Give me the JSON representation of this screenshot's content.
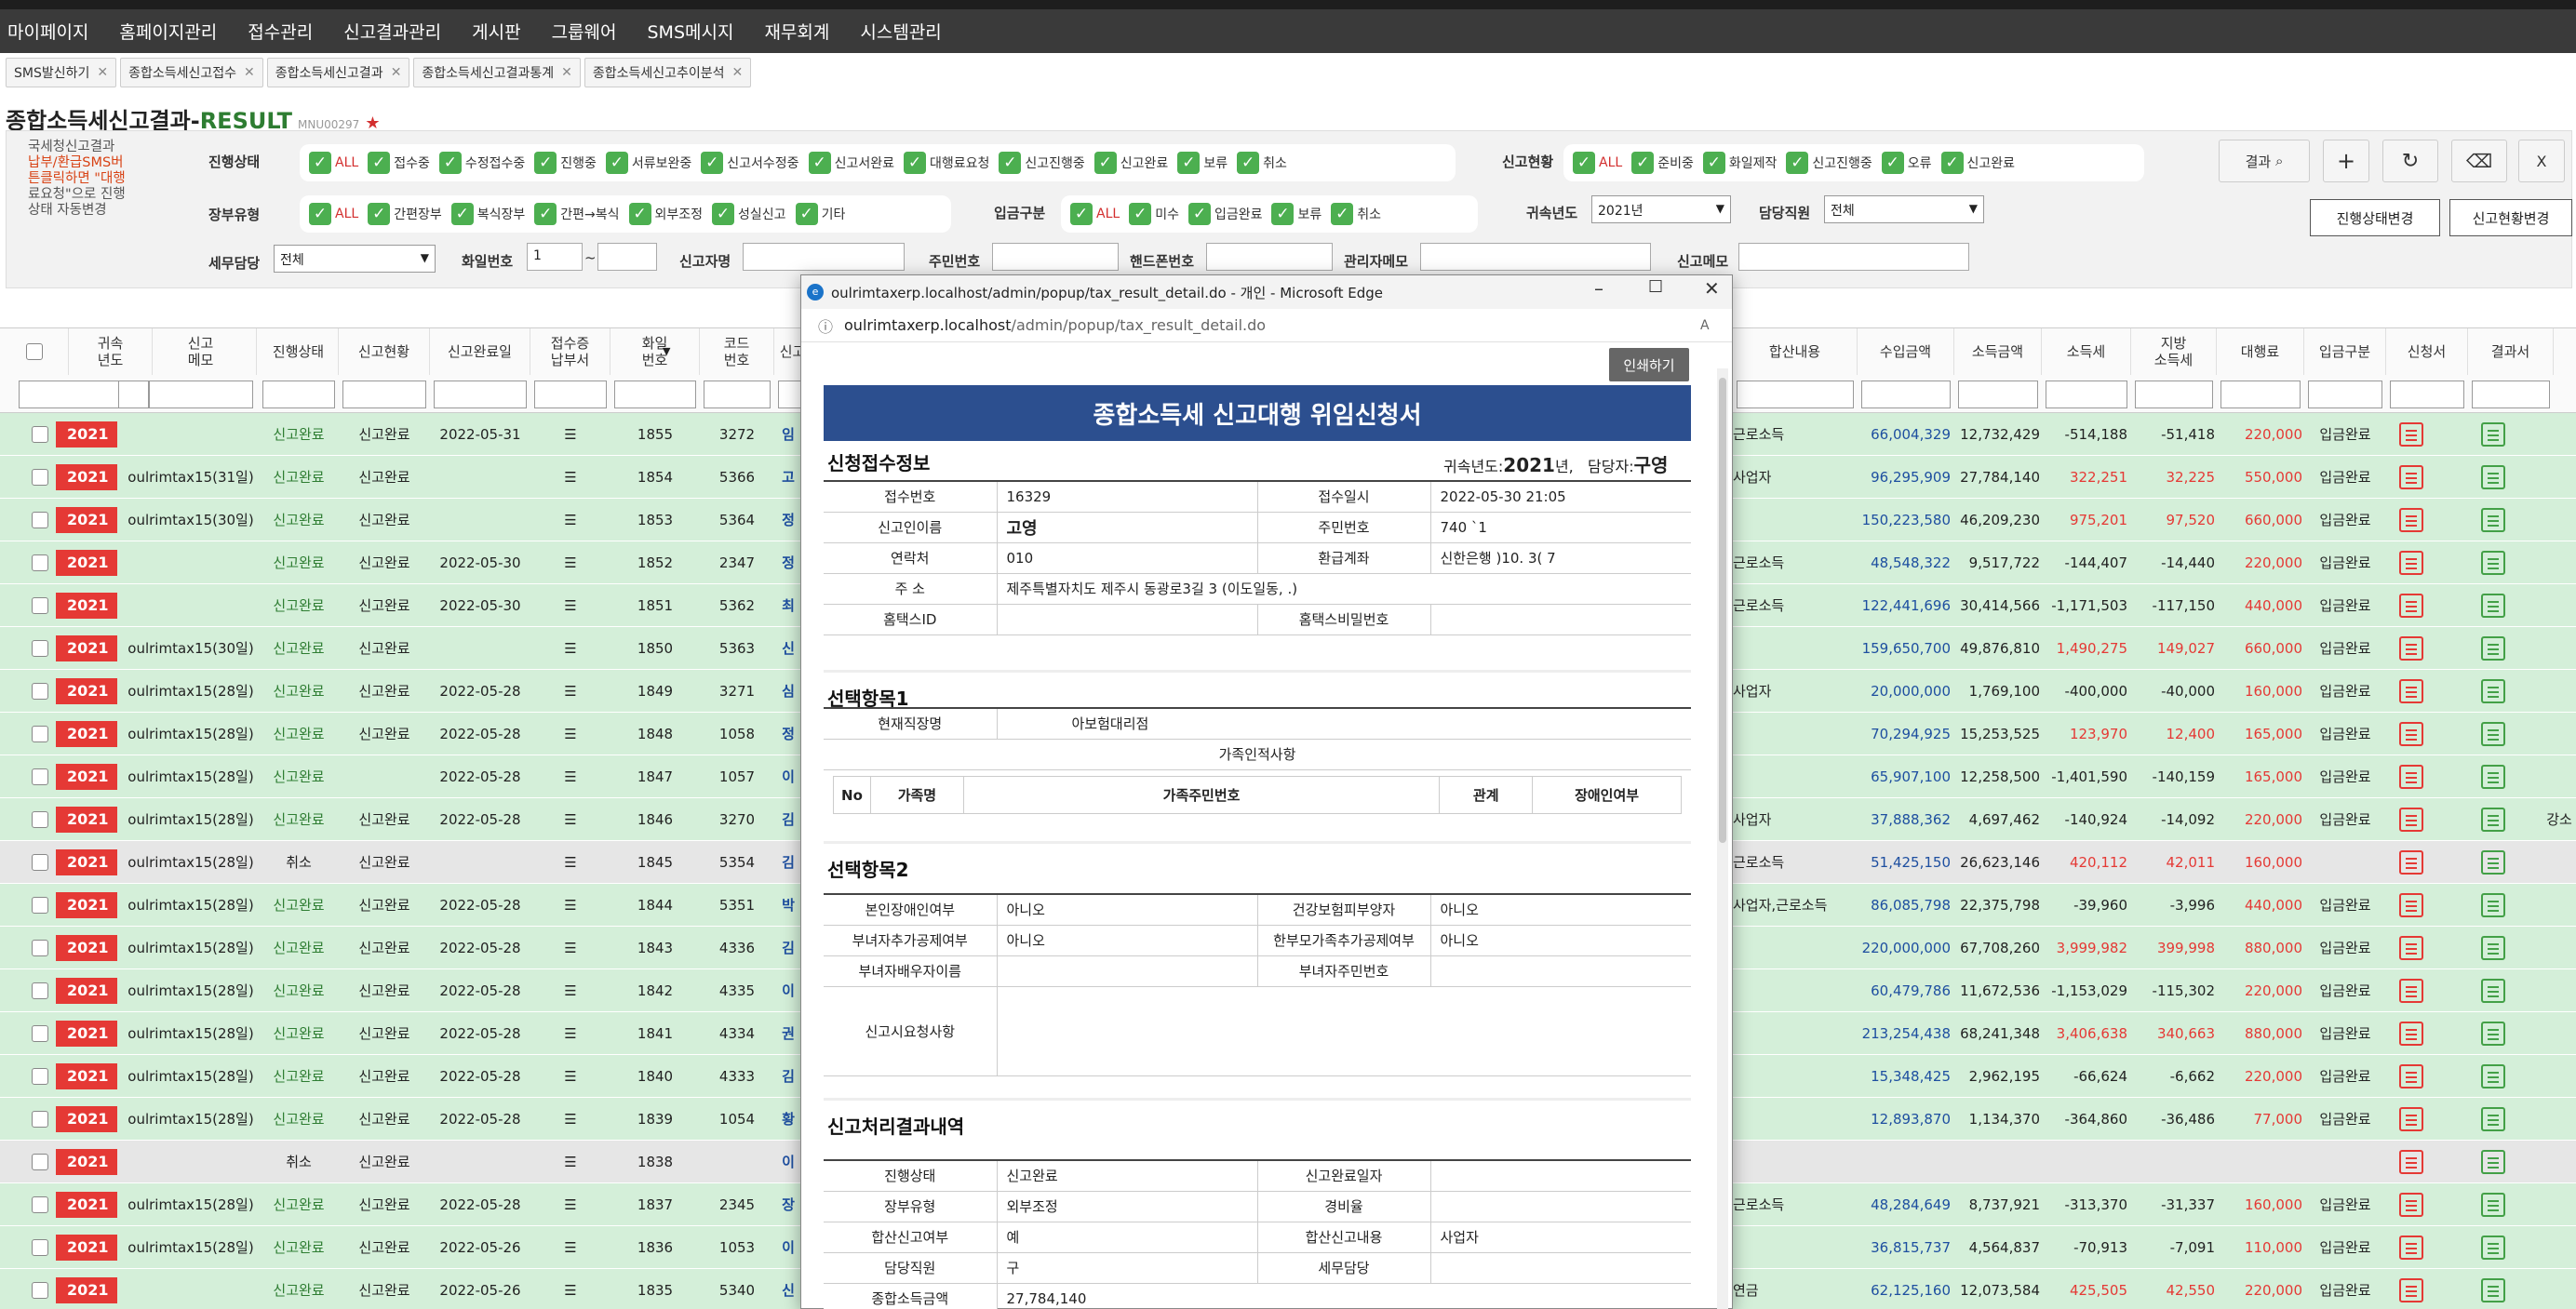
{
  "menu": [
    "마이페이지",
    "홈페이지관리",
    "접수관리",
    "신고결과관리",
    "게시판",
    "그룹웨어",
    "SMS메시지",
    "재무회계",
    "시스템관리"
  ],
  "tabs": [
    "SMS발신하기",
    "종합소득세신고접수",
    "종합소득세신고결과",
    "종합소득세신고결과통계",
    "종합소득세신고추이분석"
  ],
  "title": {
    "main": "종합소득세신고결과-",
    "suffix": "RESULT",
    "code": "MNU00297"
  },
  "notice": {
    "l1": "국세청신고결과",
    "l2": "납부/환급SMS버",
    "l3": "튼클릭하면 \"대행",
    "l4": "료요청\"으로 진행",
    "l5": "상태 자동변경"
  },
  "filters": {
    "status_label": "진행상태",
    "status": [
      "ALL",
      "접수중",
      "수정접수중",
      "진행중",
      "서류보완중",
      "신고서수정중",
      "신고서완료",
      "대행료요청",
      "신고진행중",
      "신고완료",
      "보류",
      "취소"
    ],
    "report_label": "신고현황",
    "report": [
      "ALL",
      "준비중",
      "화일제작",
      "신고진행중",
      "오류",
      "신고완료"
    ],
    "ledger_label": "장부유형",
    "ledger": [
      "ALL",
      "간편장부",
      "복식장부",
      "간편→복식",
      "외부조정",
      "성실신고",
      "기타"
    ],
    "deposit_label": "입금구분",
    "deposit": [
      "ALL",
      "미수",
      "입금완료",
      "보류",
      "취소"
    ],
    "year_label": "귀속년도",
    "year_value": "2021년",
    "staff_label": "담당직원",
    "staff_value": "전체",
    "tax_label": "세무담당",
    "tax_value": "전체",
    "file_label": "화일번호",
    "file_from": "1",
    "file_sep": "~",
    "name_label": "신고자명",
    "ssn_label": "주민번호",
    "phone_label": "핸드폰번호",
    "admin_memo_label": "관리자메모",
    "memo_label": "신고메모"
  },
  "buttons": {
    "result": "결과",
    "add": "+",
    "refresh": "↻",
    "erase": "⌫",
    "excel": "X",
    "change_status": "진행상태변경",
    "change_report": "신고현황변경"
  },
  "headers": {
    "left": [
      "귀속\n년도",
      "신고\n메모",
      "진행상태",
      "신고현황",
      "신고완료일",
      "접수증\n납부서",
      "화일\n번호",
      "코드\n번호",
      "신고"
    ],
    "right": [
      "합산내용",
      "수입금액",
      "소득금액",
      "소득세",
      "지방\n소득세",
      "대행료",
      "입금구분",
      "신청서",
      "결과서"
    ]
  },
  "rows": [
    {
      "y": "2021",
      "memo": "",
      "st": "신고완료",
      "rp": "신고완료",
      "date": "2022-05-31",
      "no": "1855",
      "code": "3272",
      "nm": "임",
      "sum": "근로소득",
      "inc": "66,004,329",
      "earn": "12,732,429",
      "tax": "-514,188",
      "local": "-51,418",
      "fee": "220,000",
      "dep": "입금완료",
      "bg": "g"
    },
    {
      "y": "2021",
      "memo": "oulrimtax15(31일)",
      "st": "신고완료",
      "rp": "신고완료",
      "date": "",
      "no": "1854",
      "code": "5366",
      "nm": "고",
      "sum": "사업자",
      "inc": "96,295,909",
      "earn": "27,784,140",
      "tax": "322,251",
      "local": "32,225",
      "fee": "550,000",
      "dep": "입금완료",
      "bg": "g"
    },
    {
      "y": "2021",
      "memo": "oulrimtax15(30일)",
      "st": "신고완료",
      "rp": "신고완료",
      "date": "",
      "no": "1853",
      "code": "5364",
      "nm": "정",
      "sum": "",
      "inc": "150,223,580",
      "earn": "46,209,230",
      "tax": "975,201",
      "local": "97,520",
      "fee": "660,000",
      "dep": "입금완료",
      "bg": "g"
    },
    {
      "y": "2021",
      "memo": "",
      "st": "신고완료",
      "rp": "신고완료",
      "date": "2022-05-30",
      "no": "1852",
      "code": "2347",
      "nm": "정",
      "sum": "근로소득",
      "inc": "48,548,322",
      "earn": "9,517,722",
      "tax": "-144,407",
      "local": "-14,440",
      "fee": "220,000",
      "dep": "입금완료",
      "bg": "g"
    },
    {
      "y": "2021",
      "memo": "",
      "st": "신고완료",
      "rp": "신고완료",
      "date": "2022-05-30",
      "no": "1851",
      "code": "5362",
      "nm": "최",
      "sum": "근로소득",
      "inc": "122,441,696",
      "earn": "30,414,566",
      "tax": "-1,171,503",
      "local": "-117,150",
      "fee": "440,000",
      "dep": "입금완료",
      "bg": "g"
    },
    {
      "y": "2021",
      "memo": "oulrimtax15(30일)",
      "st": "신고완료",
      "rp": "신고완료",
      "date": "",
      "no": "1850",
      "code": "5363",
      "nm": "신",
      "sum": "",
      "inc": "159,650,700",
      "earn": "49,876,810",
      "tax": "1,490,275",
      "local": "149,027",
      "fee": "660,000",
      "dep": "입금완료",
      "bg": "g"
    },
    {
      "y": "2021",
      "memo": "oulrimtax15(28일)",
      "st": "신고완료",
      "rp": "신고완료",
      "date": "2022-05-28",
      "no": "1849",
      "code": "3271",
      "nm": "심",
      "sum": "사업자",
      "inc": "20,000,000",
      "earn": "1,769,100",
      "tax": "-400,000",
      "local": "-40,000",
      "fee": "160,000",
      "dep": "입금완료",
      "bg": "g"
    },
    {
      "y": "2021",
      "memo": "oulrimtax15(28일)",
      "st": "신고완료",
      "rp": "신고완료",
      "date": "2022-05-28",
      "no": "1848",
      "code": "1058",
      "nm": "정",
      "sum": "",
      "inc": "70,294,925",
      "earn": "15,253,525",
      "tax": "123,970",
      "local": "12,400",
      "fee": "165,000",
      "dep": "입금완료",
      "bg": "g"
    },
    {
      "y": "2021",
      "memo": "oulrimtax15(28일)",
      "st": "신고완료",
      "rp": "",
      "date": "2022-05-28",
      "no": "1847",
      "code": "1057",
      "nm": "이",
      "sum": "",
      "inc": "65,907,100",
      "earn": "12,258,500",
      "tax": "-1,401,590",
      "local": "-140,159",
      "fee": "165,000",
      "dep": "입금완료",
      "bg": "g"
    },
    {
      "y": "2021",
      "memo": "oulrimtax15(28일)",
      "st": "신고완료",
      "rp": "신고완료",
      "date": "2022-05-28",
      "no": "1846",
      "code": "3270",
      "nm": "김",
      "sum": "사업자",
      "inc": "37,888,362",
      "earn": "4,697,462",
      "tax": "-140,924",
      "local": "-14,092",
      "fee": "220,000",
      "dep": "입금완료",
      "bg": "g",
      "extra": "강소"
    },
    {
      "y": "2021",
      "memo": "oulrimtax15(28일)",
      "st": "취소",
      "rp": "신고완료",
      "date": "",
      "no": "1845",
      "code": "5354",
      "nm": "김",
      "sum": "근로소득",
      "inc": "51,425,150",
      "earn": "26,623,146",
      "tax": "420,112",
      "local": "42,011",
      "fee": "160,000",
      "dep": "",
      "bg": "gray"
    },
    {
      "y": "2021",
      "memo": "oulrimtax15(28일)",
      "st": "신고완료",
      "rp": "신고완료",
      "date": "2022-05-28",
      "no": "1844",
      "code": "5351",
      "nm": "박",
      "sum": "사업자,근로소득",
      "inc": "86,085,798",
      "earn": "22,375,798",
      "tax": "-39,960",
      "local": "-3,996",
      "fee": "440,000",
      "dep": "입금완료",
      "bg": "g"
    },
    {
      "y": "2021",
      "memo": "oulrimtax15(28일)",
      "st": "신고완료",
      "rp": "신고완료",
      "date": "2022-05-28",
      "no": "1843",
      "code": "4336",
      "nm": "김",
      "sum": "",
      "inc": "220,000,000",
      "earn": "67,708,260",
      "tax": "3,999,982",
      "local": "399,998",
      "fee": "880,000",
      "dep": "입금완료",
      "bg": "g"
    },
    {
      "y": "2021",
      "memo": "oulrimtax15(28일)",
      "st": "신고완료",
      "rp": "신고완료",
      "date": "2022-05-28",
      "no": "1842",
      "code": "4335",
      "nm": "이",
      "sum": "",
      "inc": "60,479,786",
      "earn": "11,672,536",
      "tax": "-1,153,029",
      "local": "-115,302",
      "fee": "220,000",
      "dep": "입금완료",
      "bg": "g"
    },
    {
      "y": "2021",
      "memo": "oulrimtax15(28일)",
      "st": "신고완료",
      "rp": "신고완료",
      "date": "2022-05-28",
      "no": "1841",
      "code": "4334",
      "nm": "권",
      "sum": "",
      "inc": "213,254,438",
      "earn": "68,241,348",
      "tax": "3,406,638",
      "local": "340,663",
      "fee": "880,000",
      "dep": "입금완료",
      "bg": "g"
    },
    {
      "y": "2021",
      "memo": "oulrimtax15(28일)",
      "st": "신고완료",
      "rp": "신고완료",
      "date": "2022-05-28",
      "no": "1840",
      "code": "4333",
      "nm": "김",
      "sum": "",
      "inc": "15,348,425",
      "earn": "2,962,195",
      "tax": "-66,624",
      "local": "-6,662",
      "fee": "220,000",
      "dep": "입금완료",
      "bg": "g"
    },
    {
      "y": "2021",
      "memo": "oulrimtax15(28일)",
      "st": "신고완료",
      "rp": "신고완료",
      "date": "2022-05-28",
      "no": "1839",
      "code": "1054",
      "nm": "황",
      "sum": "",
      "inc": "12,893,870",
      "earn": "1,134,370",
      "tax": "-364,860",
      "local": "-36,486",
      "fee": "77,000",
      "dep": "입금완료",
      "bg": "g"
    },
    {
      "y": "2021",
      "memo": "",
      "st": "취소",
      "rp": "신고완료",
      "date": "",
      "no": "1838",
      "code": "",
      "nm": "이",
      "sum": "",
      "inc": "",
      "earn": "",
      "tax": "",
      "local": "",
      "fee": "",
      "dep": "",
      "bg": "gray"
    },
    {
      "y": "2021",
      "memo": "oulrimtax15(28일)",
      "st": "신고완료",
      "rp": "신고완료",
      "date": "2022-05-28",
      "no": "1837",
      "code": "2345",
      "nm": "장",
      "sum": "근로소득",
      "inc": "48,284,649",
      "earn": "8,737,921",
      "tax": "-313,370",
      "local": "-31,337",
      "fee": "160,000",
      "dep": "입금완료",
      "bg": "g"
    },
    {
      "y": "2021",
      "memo": "oulrimtax15(28일)",
      "st": "신고완료",
      "rp": "신고완료",
      "date": "2022-05-26",
      "no": "1836",
      "code": "1053",
      "nm": "이",
      "sum": "",
      "inc": "36,815,737",
      "earn": "4,564,837",
      "tax": "-70,913",
      "local": "-7,091",
      "fee": "110,000",
      "dep": "입금완료",
      "bg": "g"
    },
    {
      "y": "2021",
      "memo": "",
      "st": "신고완료",
      "rp": "신고완료",
      "date": "2022-05-26",
      "no": "1835",
      "code": "5340",
      "nm": "신",
      "sum": "연금",
      "inc": "62,125,160",
      "earn": "12,073,584",
      "tax": "425,505",
      "local": "42,550",
      "fee": "220,000",
      "dep": "입금완료",
      "bg": "g"
    }
  ],
  "popup": {
    "titlebar": "oulrimtaxerp.localhost/admin/popup/tax_result_detail.do - 개인 - Microsoft Edge",
    "host": "oulrimtaxerp.localhost",
    "path": "/admin/popup/tax_result_detail.do",
    "print": "인쇄하기",
    "form_title": "종합소득세 신고대행 위임신청서",
    "sec1": "신청접수정보",
    "year_label": "귀속년도:",
    "year": "2021",
    "year_unit": "년,",
    "staff_label": "담당자:",
    "staff": "구영",
    "info": [
      [
        "접수번호",
        "16329",
        "접수일시",
        "2022-05-30 21:05"
      ],
      [
        "신고인이름",
        "고영",
        "주민번호",
        "740        `1"
      ],
      [
        "연락처",
        "010",
        "환급계좌",
        "신한은행  )10.  3(   7"
      ],
      [
        "주 소",
        "제주특별자치도 제주시 동광로3길 3 (이도일동,                   .)",
        "",
        ""
      ],
      [
        "홈택스ID",
        "",
        "홈택스비밀번호",
        ""
      ]
    ],
    "sec2": "선택항목1",
    "job_label": "현재직장명",
    "job": "아보험대리점",
    "family_title": "가족인적사항",
    "family_headers": [
      "No",
      "가족명",
      "가족주민번호",
      "관계",
      "장애인여부"
    ],
    "sec3": "선택항목2",
    "opt2": [
      [
        "본인장애인여부",
        "아니오",
        "건강보험피부양자",
        "아니오"
      ],
      [
        "부녀자추가공제여부",
        "아니오",
        "한부모가족추가공제여부",
        "아니오"
      ],
      [
        "부녀자배우자이름",
        "",
        "부녀자주민번호",
        ""
      ],
      [
        "신고시요청사항",
        "",
        "",
        ""
      ]
    ],
    "sec4": "신고처리결과내역",
    "result": [
      [
        "진행상태",
        "신고완료",
        "신고완료일자",
        ""
      ],
      [
        "장부유형",
        "외부조정",
        "경비율",
        ""
      ],
      [
        "합산신고여부",
        "예",
        "합산신고내용",
        "사업자"
      ],
      [
        "담당직원",
        "구",
        "세무담당",
        ""
      ],
      [
        "종합소득금액",
        "27,784,140",
        "",
        ""
      ]
    ]
  }
}
